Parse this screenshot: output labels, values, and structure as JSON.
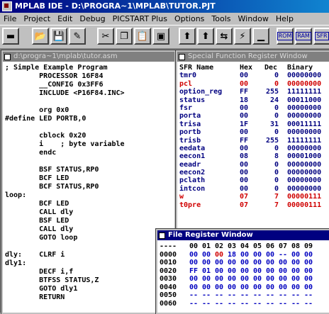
{
  "app": {
    "title": "MPLAB IDE - D:\\PROGRA~1\\MPLAB\\TUTOR.PJT"
  },
  "menu": [
    "File",
    "Project",
    "Edit",
    "Debug",
    "PICSTART Plus",
    "Options",
    "Tools",
    "Window",
    "Help"
  ],
  "toolbar": {
    "buttons": [
      {
        "name": "toggle-window-icon",
        "glyph": "▬"
      },
      {
        "name": "open-icon",
        "glyph": "📂"
      },
      {
        "name": "save-icon",
        "glyph": "💾"
      },
      {
        "name": "wand-icon",
        "glyph": "✎"
      },
      {
        "name": "cut-icon",
        "glyph": "✂"
      },
      {
        "name": "copy-icon",
        "glyph": "❐"
      },
      {
        "name": "paste-icon",
        "glyph": "📋"
      },
      {
        "name": "print-icon",
        "glyph": "▣"
      },
      {
        "name": "run-icon",
        "glyph": "⬆"
      },
      {
        "name": "halt-icon",
        "glyph": "⬆"
      },
      {
        "name": "step-icon",
        "glyph": "⇆"
      },
      {
        "name": "animate-icon",
        "glyph": "⚡"
      },
      {
        "name": "reset-icon",
        "glyph": "▁"
      }
    ],
    "text_buttons": [
      "ROM",
      "RAM",
      "SFR"
    ]
  },
  "source_window": {
    "title": "d:\\progra~1\\mplab\\tutor.asm",
    "lines": [
      "; Simple Example Program",
      "        PROCESSOR 16F84",
      "        __CONFIG 0x3FF6",
      "        INCLUDE <P16F84.INC>",
      "",
      "        org 0x0",
      "#define LED PORTB,0",
      "",
      "        cblock 0x20",
      "        i    ; byte variable",
      "        endc",
      "",
      "        BSF STATUS,RP0",
      "        BCF LED",
      "        BCF STATUS,RP0",
      "loop:",
      "        BCF LED",
      "        CALL dly",
      "        BSF LED",
      "        CALL dly",
      "        GOTO loop",
      "",
      "dly:    CLRF i",
      "dly1:",
      "        DECF i,f",
      "        BTFSS STATUS,Z",
      "        GOTO dly1",
      "        RETURN"
    ]
  },
  "sfr_window": {
    "title": "Special Function Register Window",
    "headers": [
      "SFR Name",
      "Hex",
      "Dec",
      "Binary"
    ],
    "rows": [
      {
        "name": "tmr0",
        "hex": "00",
        "dec": "0",
        "bin": "00000000",
        "changed": false
      },
      {
        "name": "pcl",
        "hex": "00",
        "dec": "0",
        "bin": "00000000",
        "changed": true
      },
      {
        "name": "option_reg",
        "hex": "FF",
        "dec": "255",
        "bin": "11111111",
        "changed": false
      },
      {
        "name": "status",
        "hex": "18",
        "dec": "24",
        "bin": "00011000",
        "changed": false
      },
      {
        "name": "fsr",
        "hex": "00",
        "dec": "0",
        "bin": "00000000",
        "changed": false
      },
      {
        "name": "porta",
        "hex": "00",
        "dec": "0",
        "bin": "00000000",
        "changed": false
      },
      {
        "name": "trisa",
        "hex": "1F",
        "dec": "31",
        "bin": "00011111",
        "changed": false
      },
      {
        "name": "portb",
        "hex": "00",
        "dec": "0",
        "bin": "00000000",
        "changed": false
      },
      {
        "name": "trisb",
        "hex": "FF",
        "dec": "255",
        "bin": "11111111",
        "changed": false
      },
      {
        "name": "eedata",
        "hex": "00",
        "dec": "0",
        "bin": "00000000",
        "changed": false
      },
      {
        "name": "eecon1",
        "hex": "08",
        "dec": "8",
        "bin": "00001000",
        "changed": false
      },
      {
        "name": "eeadr",
        "hex": "00",
        "dec": "0",
        "bin": "00000000",
        "changed": false
      },
      {
        "name": "eecon2",
        "hex": "00",
        "dec": "0",
        "bin": "00000000",
        "changed": false
      },
      {
        "name": "pclath",
        "hex": "00",
        "dec": "0",
        "bin": "00000000",
        "changed": false
      },
      {
        "name": "intcon",
        "hex": "00",
        "dec": "0",
        "bin": "00000000",
        "changed": false
      },
      {
        "name": "w",
        "hex": "07",
        "dec": "7",
        "bin": "00000111",
        "changed": true
      },
      {
        "name": "t0pre",
        "hex": "07",
        "dec": "7",
        "bin": "00000111",
        "changed": true
      }
    ]
  },
  "file_register_window": {
    "title": "File Register Window",
    "header_addr": "----",
    "columns": [
      "00",
      "01",
      "02",
      "03",
      "04",
      "05",
      "06",
      "07",
      "08",
      "09"
    ],
    "rows": [
      {
        "addr": "0000",
        "cells": [
          [
            "00",
            "b"
          ],
          [
            "00",
            "b"
          ],
          [
            "00",
            "r"
          ],
          [
            "18",
            "b"
          ],
          [
            "00",
            "b"
          ],
          [
            "00",
            "b"
          ],
          [
            "00",
            "b"
          ],
          [
            "--",
            "b"
          ],
          [
            "00",
            "b"
          ],
          [
            "00",
            "b"
          ]
        ]
      },
      {
        "addr": "0010",
        "cells": [
          [
            "00",
            "b"
          ],
          [
            "00",
            "b"
          ],
          [
            "00",
            "b"
          ],
          [
            "00",
            "b"
          ],
          [
            "00",
            "b"
          ],
          [
            "00",
            "b"
          ],
          [
            "00",
            "b"
          ],
          [
            "00",
            "b"
          ],
          [
            "00",
            "b"
          ],
          [
            "00",
            "b"
          ]
        ]
      },
      {
        "addr": "0020",
        "cells": [
          [
            "FF",
            "b"
          ],
          [
            "01",
            "b"
          ],
          [
            "00",
            "b"
          ],
          [
            "00",
            "b"
          ],
          [
            "00",
            "b"
          ],
          [
            "00",
            "b"
          ],
          [
            "00",
            "b"
          ],
          [
            "00",
            "b"
          ],
          [
            "00",
            "b"
          ],
          [
            "00",
            "b"
          ]
        ]
      },
      {
        "addr": "0030",
        "cells": [
          [
            "00",
            "b"
          ],
          [
            "00",
            "b"
          ],
          [
            "00",
            "b"
          ],
          [
            "00",
            "b"
          ],
          [
            "00",
            "b"
          ],
          [
            "00",
            "b"
          ],
          [
            "00",
            "b"
          ],
          [
            "00",
            "b"
          ],
          [
            "00",
            "b"
          ],
          [
            "00",
            "b"
          ]
        ]
      },
      {
        "addr": "0040",
        "cells": [
          [
            "00",
            "b"
          ],
          [
            "00",
            "b"
          ],
          [
            "00",
            "b"
          ],
          [
            "00",
            "b"
          ],
          [
            "00",
            "b"
          ],
          [
            "00",
            "b"
          ],
          [
            "00",
            "b"
          ],
          [
            "00",
            "b"
          ],
          [
            "00",
            "b"
          ],
          [
            "00",
            "b"
          ]
        ]
      },
      {
        "addr": "0050",
        "cells": [
          [
            "--",
            "b"
          ],
          [
            "--",
            "b"
          ],
          [
            "--",
            "b"
          ],
          [
            "--",
            "b"
          ],
          [
            "--",
            "b"
          ],
          [
            "--",
            "b"
          ],
          [
            "--",
            "b"
          ],
          [
            "--",
            "b"
          ],
          [
            "--",
            "b"
          ],
          [
            "--",
            "b"
          ]
        ]
      },
      {
        "addr": "0060",
        "cells": [
          [
            "--",
            "b"
          ],
          [
            "--",
            "b"
          ],
          [
            "--",
            "b"
          ],
          [
            "--",
            "b"
          ],
          [
            "--",
            "b"
          ],
          [
            "--",
            "b"
          ],
          [
            "--",
            "b"
          ],
          [
            "--",
            "b"
          ],
          [
            "--",
            "b"
          ],
          [
            "--",
            "b"
          ]
        ]
      }
    ]
  }
}
